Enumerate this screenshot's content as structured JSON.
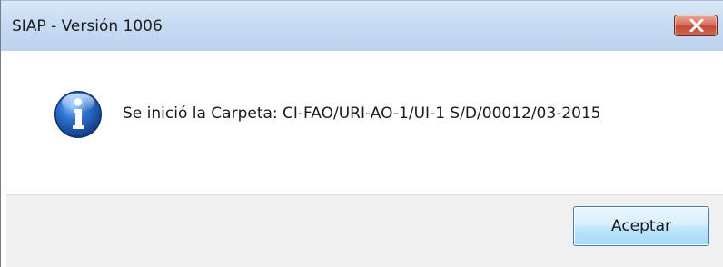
{
  "dialog": {
    "title": "SIAP - Versión 1006",
    "message": "Se inició la Carpeta: CI-FAO/URI-AO-1/UI-1 S/D/00012/03-2015",
    "icon": "info-icon",
    "ok_label": "Aceptar",
    "close_icon": "close-icon"
  },
  "colors": {
    "titlebar": "#c7dbf3",
    "close_button": "#c24a35",
    "footer": "#f0f0f0",
    "ok_button_border": "#3c7fb1"
  }
}
